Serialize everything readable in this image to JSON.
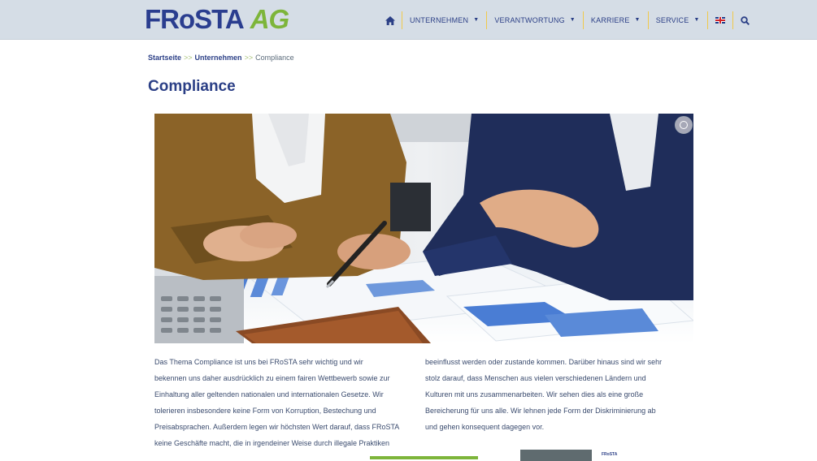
{
  "logo": {
    "part1": "FRoSTA",
    "part2": "AG"
  },
  "nav": {
    "items": [
      {
        "label": "UNTERNEHMEN",
        "has_dropdown": true
      },
      {
        "label": "VERANTWORTUNG",
        "has_dropdown": true
      },
      {
        "label": "KARRIERE",
        "has_dropdown": true
      },
      {
        "label": "SERVICE",
        "has_dropdown": true
      }
    ],
    "caret": "▼",
    "icons": [
      "home-icon",
      "uk-flag-icon",
      "search-icon"
    ]
  },
  "breadcrumb": {
    "home": "Startseite",
    "separator": ">>",
    "parent": "Unternehmen",
    "current": "Compliance"
  },
  "page": {
    "title": "Compliance"
  },
  "content": {
    "col1": [
      "Das Thema Compliance ist uns bei FRoSTA sehr wichtig und wir",
      "bekennen uns daher ausdrücklich zu einem fairen Wettbewerb sowie zur",
      "Einhaltung aller geltenden nationalen und internationalen Gesetze. Wir",
      "tolerieren insbesondere keine Form von Korruption, Bestechung und",
      "Preisabsprachen. Außerdem legen wir höchsten Wert darauf, dass FRoSTA",
      "keine Geschäfte macht, die in irgendeiner Weise durch illegale Praktiken"
    ],
    "col2": [
      "beeinflusst werden oder zustande kommen. Darüber hinaus sind wir sehr",
      "stolz darauf, dass Menschen aus vielen verschiedenen Ländern und",
      "Kulturen mit uns zusammenarbeiten. Wir sehen dies als eine große",
      "Bereicherung für uns alle. Wir lehnen jede Form der Diskriminierung ab",
      "und gehen konsequent dagegen vor."
    ]
  },
  "footer_peek": {
    "mini_logo": "FRoSTA"
  },
  "colors": {
    "brand_blue": "#2b3f86",
    "brand_green": "#7db53a",
    "header_bg": "#d5dde6",
    "separator": "#f1c94a"
  }
}
